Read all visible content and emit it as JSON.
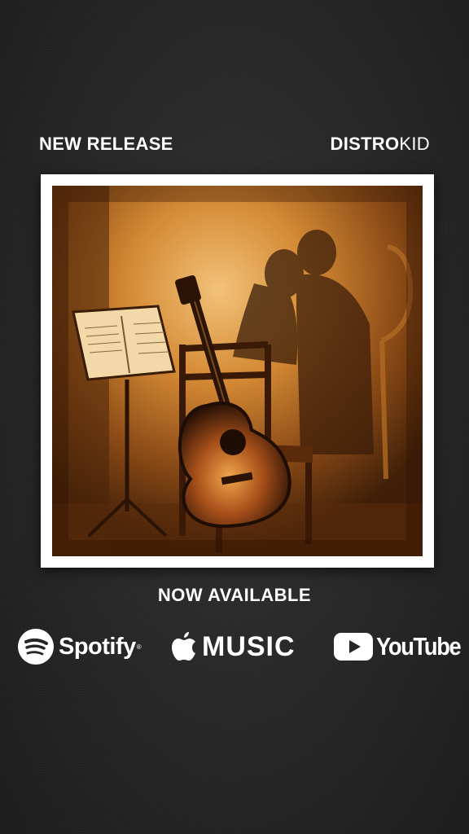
{
  "header": {
    "left_label": "NEW RELEASE",
    "brand_bold": "DISTRO",
    "brand_light": "KID"
  },
  "artwork": {
    "description_icon": "album-cover-artwork"
  },
  "availability": {
    "label": "NOW AVAILABLE"
  },
  "platforms": {
    "spotify": {
      "label": "Spotify",
      "tm": "®",
      "icon": "spotify-icon"
    },
    "apple": {
      "label": "MUSIC",
      "icon": "apple-icon"
    },
    "youtube": {
      "label": "YouTube",
      "icon": "youtube-play-icon"
    }
  },
  "colors": {
    "background": "#262626",
    "frame": "#ffffff",
    "art_warm": "#c8741f",
    "art_dark": "#3a1d08"
  }
}
